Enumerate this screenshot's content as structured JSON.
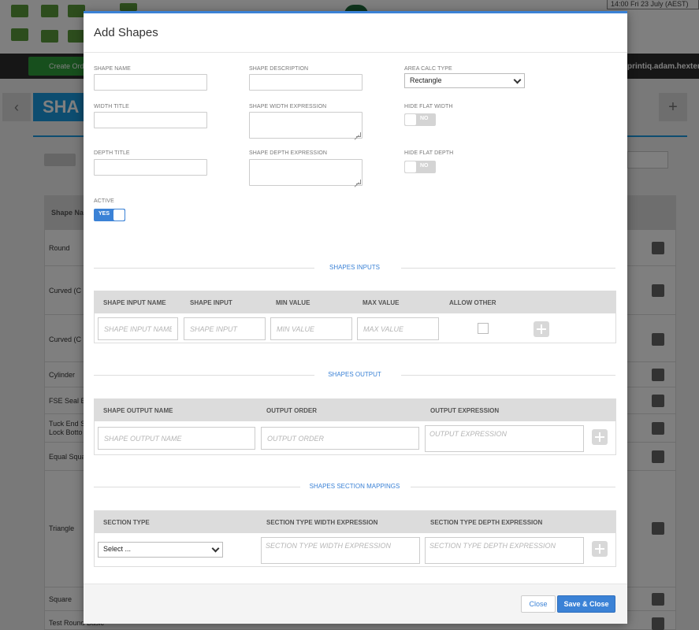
{
  "background": {
    "create_label": "Create Ord",
    "user_label": "printiq.adam.hexter",
    "date_label": "14:00 Fri 23 July (AEST)",
    "page_title": "SHA",
    "table_header": "Shape Na",
    "rows": [
      "Round",
      "Curved (C",
      "Curved (C",
      "Cylinder",
      "FSE Seal E",
      "Tuck End S",
      "Equal Squa",
      "Triangle",
      "Square",
      "Test Round Basic"
    ],
    "row_extra": "Lock Botto"
  },
  "modal": {
    "title": "Add Shapes",
    "fields": {
      "shape_name_label": "SHAPE NAME",
      "shape_description_label": "SHAPE DESCRIPTION",
      "area_calc_type_label": "AREA CALC TYPE",
      "area_calc_type_value": "Rectangle",
      "width_title_label": "WIDTH TITLE",
      "shape_width_expression_label": "SHAPE WIDTH EXPRESSION",
      "hide_flat_width_label": "HIDE FLAT WIDTH",
      "hide_flat_width_value": "NO",
      "depth_title_label": "DEPTH TITLE",
      "shape_depth_expression_label": "SHAPE DEPTH EXPRESSION",
      "hide_flat_depth_label": "HIDE FLAT DEPTH",
      "hide_flat_depth_value": "NO",
      "active_label": "ACTIVE",
      "active_value": "YES"
    },
    "shapes_inputs": {
      "heading": "SHAPES INPUTS",
      "columns": [
        "SHAPE INPUT NAME",
        "SHAPE INPUT",
        "MIN VALUE",
        "MAX VALUE",
        "ALLOW OTHER"
      ],
      "placeholders": {
        "name": "SHAPE INPUT NAME",
        "input": "SHAPE INPUT",
        "min": "MIN VALUE",
        "max": "MAX VALUE"
      }
    },
    "shapes_output": {
      "heading": "SHAPES OUTPUT",
      "columns": [
        "SHAPE OUTPUT NAME",
        "OUTPUT ORDER",
        "OUTPUT EXPRESSION"
      ],
      "placeholders": {
        "name": "SHAPE OUTPUT NAME",
        "order": "OUTPUT ORDER",
        "expression": "OUTPUT EXPRESSION"
      }
    },
    "section_mappings": {
      "heading": "SHAPES SECTION MAPPINGS",
      "columns": [
        "SECTION TYPE",
        "SECTION TYPE WIDTH EXPRESSION",
        "SECTION TYPE DEPTH EXPRESSION"
      ],
      "select_value": "Select ...",
      "placeholders": {
        "width": "SECTION TYPE WIDTH EXPRESSION",
        "depth": "SECTION TYPE DEPTH EXPRESSION"
      }
    },
    "footer": {
      "close_label": "Close",
      "save_label": "Save & Close"
    }
  },
  "colors": {
    "accent": "#3b82d6",
    "overlay": "#000000"
  }
}
